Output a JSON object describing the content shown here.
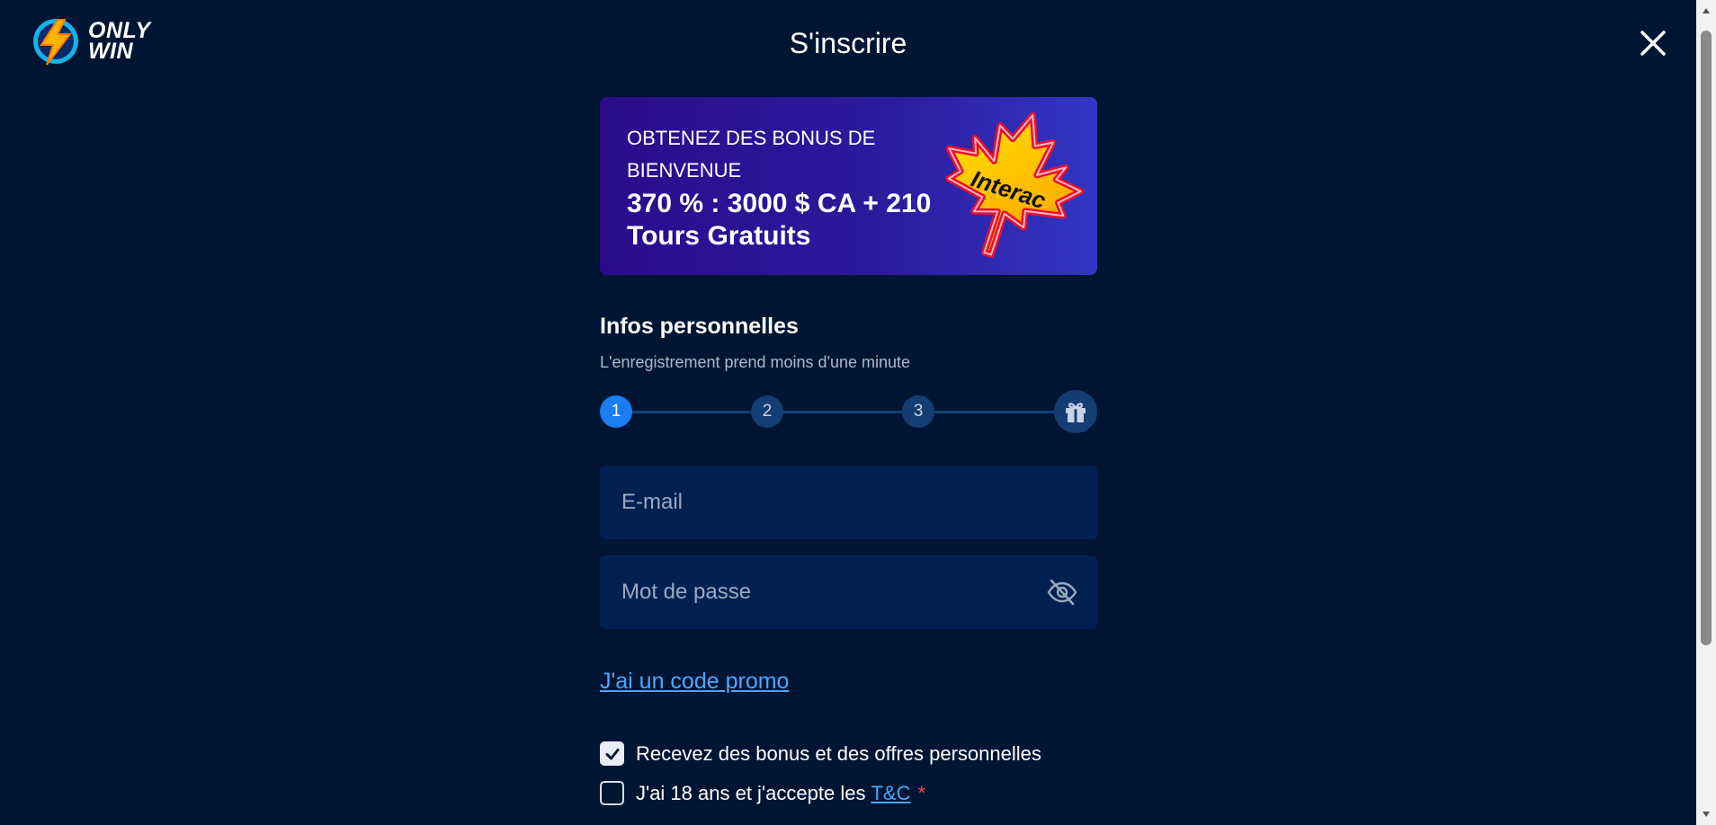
{
  "header": {
    "logo_line1": "ONLY",
    "logo_line2": "WIN",
    "title": "S'inscrire",
    "close_icon": "close-icon"
  },
  "banner": {
    "subtitle": "OBTENEZ DES BONUS DE BIENVENUE",
    "headline": "370 % : 3000 $ CA + 210 Tours Gratuits",
    "leaf_label": "Interac"
  },
  "personal": {
    "title": "Infos personnelles",
    "subtitle": "L'enregistrement prend moins d'une minute"
  },
  "steps": [
    {
      "label": "1",
      "active": true
    },
    {
      "label": "2",
      "active": false
    },
    {
      "label": "3",
      "active": false
    },
    {
      "label": "",
      "icon": "gift-icon",
      "active": false
    }
  ],
  "form": {
    "email_placeholder": "E-mail",
    "email_value": "",
    "password_placeholder": "Mot de passe",
    "password_value": "",
    "promo_link": "J'ai un code promo"
  },
  "consents": {
    "bonus_label": "Recevez des bonus et des offres personnelles",
    "bonus_checked": true,
    "age_label": "J'ai 18 ans et j'accepte les",
    "tc_link": "T&C",
    "required_mark": "*",
    "age_checked": false
  },
  "colors": {
    "background": "#001533",
    "accent": "#1a7df0",
    "link": "#4ea6ff",
    "input_bg": "#002150",
    "required": "#ff3b4a"
  }
}
